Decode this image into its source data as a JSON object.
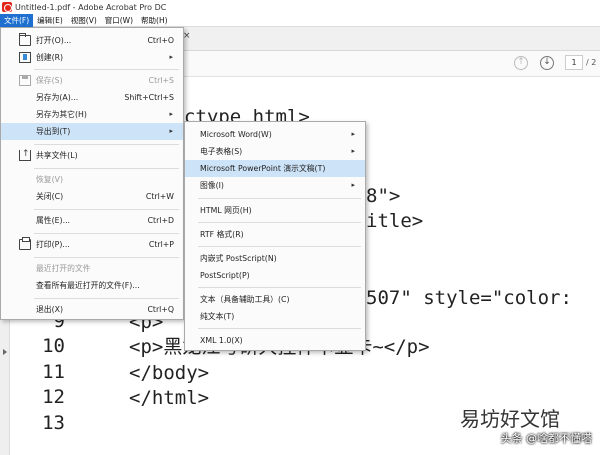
{
  "window": {
    "title": "Untitled-1.pdf - Adobe Acrobat Pro DC"
  },
  "menubar": [
    {
      "label": "文件(F)",
      "active": true
    },
    {
      "label": "编辑(E)"
    },
    {
      "label": "视图(V)"
    },
    {
      "label": "窗口(W)"
    },
    {
      "label": "帮助(H)"
    }
  ],
  "tab": {
    "close": "×"
  },
  "toolbar": {
    "page_current": "1",
    "page_total": "/ 2",
    "prev_glyph": "↑",
    "next_glyph": "↓"
  },
  "file_menu": {
    "open": {
      "label": "打开(O)...",
      "shortcut": "Ctrl+O"
    },
    "create": {
      "label": "创建(R)"
    },
    "save": {
      "label": "保存(S)",
      "shortcut": "Ctrl+S"
    },
    "save_as": {
      "label": "另存为(A)...",
      "shortcut": "Shift+Ctrl+S"
    },
    "save_as_other": {
      "label": "另存为其它(H)"
    },
    "export_to": {
      "label": "导出到(T)"
    },
    "share_file": {
      "label": "共享文件(L)"
    },
    "revert": {
      "label": "恢复(V)"
    },
    "close": {
      "label": "关闭(C)",
      "shortcut": "Ctrl+W"
    },
    "properties": {
      "label": "属性(E)...",
      "shortcut": "Ctrl+D"
    },
    "print": {
      "label": "打印(P)...",
      "shortcut": "Ctrl+P"
    },
    "recent_files": {
      "label": "最近打开的文件"
    },
    "view_all_recent": {
      "label": "查看所有最近打开的文件(F)..."
    },
    "exit": {
      "label": "退出(X)",
      "shortcut": "Ctrl+Q"
    },
    "arrow": "▸"
  },
  "export_submenu": {
    "word": {
      "label": "Microsoft Word(W)"
    },
    "spreadsheet": {
      "label": "电子表格(S)"
    },
    "powerpoint": {
      "label": "Microsoft PowerPoint 演示文稿(T)"
    },
    "image": {
      "label": "图像(I)"
    },
    "html": {
      "label": "HTML 网页(H)"
    },
    "rtf": {
      "label": "RTF 格式(R)"
    },
    "encapsulated_ps": {
      "label": "内嵌式 PostScript(N)"
    },
    "postscript": {
      "label": "PostScript(P)"
    },
    "text_accessible": {
      "label": "文本（具备辅助工具）(C)"
    },
    "plain_text": {
      "label": "纯文本(T)"
    },
    "xml": {
      "label": "XML 1.0(X)"
    },
    "arrow": "▸"
  },
  "document": {
    "fragments": {
      "doctype": "ctype html>",
      "meta_tail": "8\">",
      "title_tail": "itle>",
      "style_tail": "507\" style=\"color:",
      "p1": "<p>",
      "p2": "<p>黑龙江考研大挂件卡显卡~</p>",
      "body_close": "</body>",
      "html_close": "</html>"
    },
    "line_numbers": {
      "l9": "9",
      "l10": "10",
      "l11": "11",
      "l12": "12",
      "l13": "13"
    }
  },
  "watermark": {
    "main": "易坊好文馆",
    "sub": "头条 @啥都不懂嗒"
  }
}
